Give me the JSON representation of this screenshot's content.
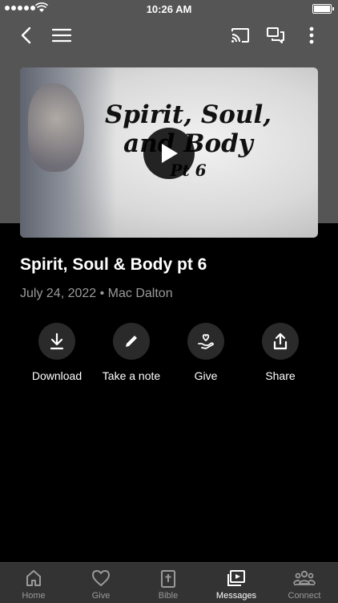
{
  "status_bar": {
    "time": "10:26 AM"
  },
  "video": {
    "thumbnail_title_line1": "Spirit, Soul,",
    "thumbnail_title_line2": "and Body",
    "thumbnail_title_line3": "Pt 6"
  },
  "message": {
    "title": "Spirit, Soul & Body pt 6",
    "meta": "July 24, 2022 • Mac Dalton"
  },
  "actions": [
    {
      "label": "Download",
      "icon": "download-icon"
    },
    {
      "label": "Take a note",
      "icon": "pencil-icon"
    },
    {
      "label": "Give",
      "icon": "heart-hand-icon"
    },
    {
      "label": "Share",
      "icon": "share-icon"
    }
  ],
  "tabs": [
    {
      "label": "Home",
      "icon": "home-icon"
    },
    {
      "label": "Give",
      "icon": "heart-icon"
    },
    {
      "label": "Bible",
      "icon": "bible-icon"
    },
    {
      "label": "Messages",
      "icon": "messages-icon",
      "active": true
    },
    {
      "label": "Connect",
      "icon": "people-icon"
    }
  ]
}
